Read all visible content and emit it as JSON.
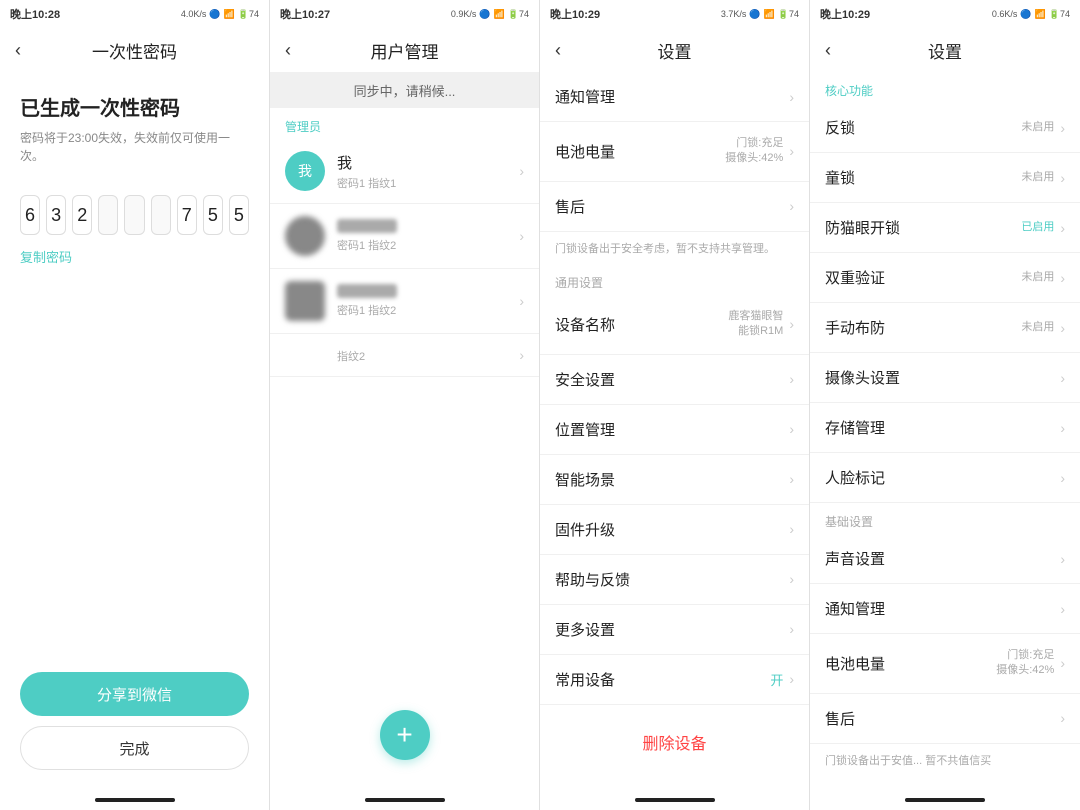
{
  "panel1": {
    "status": {
      "time": "晚上10:28",
      "network": "4.0K/s",
      "icons": "🔵 📶 🔋"
    },
    "nav": {
      "back": "‹",
      "title": "一次性密码"
    },
    "otp_title": "已生成一次性密码",
    "otp_desc": "密码将于23:00失效，失效前仅可使用一次。",
    "digits": [
      "6",
      "3",
      "2",
      "",
      "",
      "",
      "7",
      "5",
      "5"
    ],
    "copy_label": "复制密码",
    "share_btn": "分享到微信",
    "done_btn": "完成"
  },
  "panel2": {
    "status": {
      "time": "晚上10:27",
      "network": "0.9K/s"
    },
    "nav": {
      "back": "‹",
      "title": "用户管理"
    },
    "sync_text": "同步中，请稍候...",
    "admin_label": "管理员",
    "users": [
      {
        "name": "我",
        "sub": "密码1  指纹1",
        "type": "me"
      },
      {
        "name": "",
        "sub": "密码1  指纹2",
        "type": "blurred"
      },
      {
        "name": "",
        "sub": "密码1  指纹2",
        "type": "blurred2"
      },
      {
        "name": "",
        "sub": "指纹2",
        "type": "blurred3"
      }
    ],
    "fab_icon": "+"
  },
  "panel3": {
    "status": {
      "time": "晚上10:29",
      "network": "3.7K/s"
    },
    "nav": {
      "back": "‹",
      "title": "设置"
    },
    "items_top": [
      {
        "label": "通知管理",
        "value": "",
        "chevron": true
      },
      {
        "label": "电池电量",
        "value": "门锁:充足\n摄像头:42%",
        "chevron": true
      },
      {
        "label": "售后",
        "value": "",
        "chevron": true
      }
    ],
    "notice": "门锁设备出于安全考虑，暂不支持共享管理。",
    "section_general": "通用设置",
    "items_general": [
      {
        "label": "设备名称",
        "value": "鹿客猫眼智能锁R1M",
        "chevron": true
      },
      {
        "label": "安全设置",
        "value": "",
        "chevron": true
      },
      {
        "label": "位置管理",
        "value": "",
        "chevron": true
      },
      {
        "label": "智能场景",
        "value": "",
        "chevron": true
      },
      {
        "label": "固件升级",
        "value": "",
        "chevron": true
      },
      {
        "label": "帮助与反馈",
        "value": "",
        "chevron": true
      },
      {
        "label": "更多设置",
        "value": "",
        "chevron": true
      },
      {
        "label": "常用设备",
        "value": "开",
        "chevron": false,
        "toggle": true
      }
    ],
    "delete_btn": "删除设备"
  },
  "panel4": {
    "status": {
      "time": "晚上10:29",
      "network": "0.6K/s"
    },
    "nav": {
      "back": "‹",
      "title": "设置"
    },
    "section_core": "核心功能",
    "items_core": [
      {
        "label": "反锁",
        "value": "未启用",
        "chevron": true
      },
      {
        "label": "童锁",
        "value": "未启用",
        "chevron": true
      },
      {
        "label": "防猫眼开锁",
        "value": "已启用",
        "chevron": true
      },
      {
        "label": "双重验证",
        "value": "未启用",
        "chevron": true
      },
      {
        "label": "手动布防",
        "value": "未启用",
        "chevron": true
      },
      {
        "label": "摄像头设置",
        "value": "",
        "chevron": true
      },
      {
        "label": "存储管理",
        "value": "",
        "chevron": true
      },
      {
        "label": "人脸标记",
        "value": "",
        "chevron": true
      }
    ],
    "section_basic": "基础设置",
    "items_basic": [
      {
        "label": "声音设置",
        "value": "",
        "chevron": true
      },
      {
        "label": "通知管理",
        "value": "",
        "chevron": true
      },
      {
        "label": "电池电量",
        "value": "门锁:充足\n摄像头:42%",
        "chevron": true
      },
      {
        "label": "售后",
        "value": "",
        "chevron": true
      }
    ],
    "notice_bottom": "门锁设备出于安值... 暂不共值信买"
  }
}
